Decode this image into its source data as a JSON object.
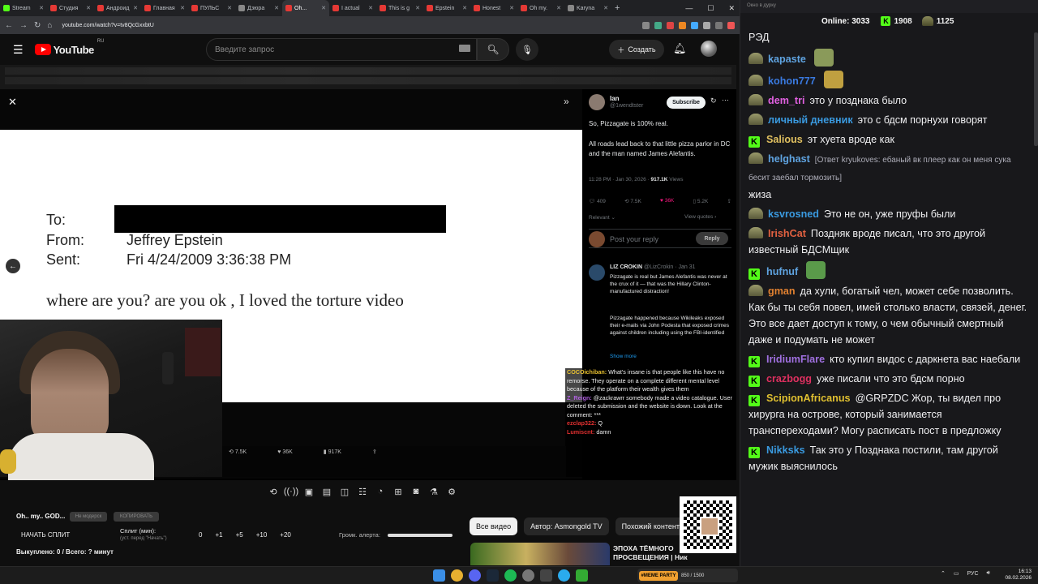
{
  "browser": {
    "tabs": [
      "Stream",
      "Студия",
      "Андроид",
      "Главная",
      "ПУЛЬС",
      "Дзюра",
      "Oh...",
      "I actual",
      "This is g",
      "Epstein",
      "Honest",
      "Oh my.",
      "Karyna"
    ],
    "active_tab": 6,
    "url": "youtube.com/watch?v=tv8QcGxxbtU"
  },
  "youtube": {
    "logo": "YouTube",
    "region": "RU",
    "search_placeholder": "Введите запрос",
    "create_label": "Создать"
  },
  "tweet": {
    "name": "Ian",
    "handle": "@1wendtster",
    "subscribe": "Subscribe",
    "text1": "So, Pizzagate is 100% real.",
    "text2": "All roads lead back to that little pizza parlor in DC and the man named James Alefantis.",
    "time": "11:28 PM · Jan 30, 2026 · ",
    "views": "917.1K",
    "views_label": " Views",
    "replies": "409",
    "retweets": "7.5K",
    "likes": "36K",
    "bookmarks": "5.2K",
    "relevant": "Relevant ⌄",
    "view_quotes": "View quotes ›",
    "reply_placeholder": "Post your reply",
    "reply_button": "Reply",
    "liz_name": "LIZ CROKIN",
    "liz_meta": " @LizCrokin · Jan 31",
    "liz_text1": "Pizzagate is real but James Alefantis was never at the crux of it — that was the Hillary Clinton-manufactured distraction!",
    "liz_text2": "Pizzagate happened because Wikileaks exposed their e-mails via John Podesta that exposed crimes against children including using the FBI-identified",
    "show_more": "Show more"
  },
  "document": {
    "to_label": "To:",
    "from_label": "From:",
    "from_value": "Jeffrey Epstein",
    "sent_label": "Sent:",
    "sent_value": "Fri 4/24/2009 3:36:38 PM",
    "body": "where are you? are you ok , I loved the torture video"
  },
  "video_footer": {
    "retweets": "7.5K",
    "likes": "36K",
    "views": "917K"
  },
  "chat_overlay": [
    {
      "user": "COCOichiban:",
      "color": "#e8c030",
      "text": " What's insane is that people like this have no remorse. They operate on a complete different mental level because of the platform their wealth gives them"
    },
    {
      "user": "Z_Reign:",
      "color": "#b060e0",
      "text": " @zackrawrr somebody made a video catalogue. User deleted the submission and the website is down. Look at the comment: ***"
    },
    {
      "user": "ezclap322:",
      "color": "#e03030",
      "text": " Q"
    },
    {
      "user": "Lumiscnt:",
      "color": "#e03030",
      "text": " damn"
    }
  ],
  "bottom": {
    "title": "Oh.. my.. GOD...",
    "no_mod": "Не модерск",
    "copy": "КОПИРОВАТЬ",
    "split_button": "НАЧАТЬ СПЛИТ",
    "split_label": "Сплит (мин):",
    "split_sub": "(уст. перед \"Начать\")",
    "split_values": [
      "0",
      "+1",
      "+5",
      "+10",
      "+20"
    ],
    "alert_label": "Громк. алерта:",
    "bought": "Выкуплено: 0 / Всего: ? минут"
  },
  "chips": [
    "Все видео",
    "Автор: Asmongold TV",
    "Похожий контент"
  ],
  "next_video": {
    "title": "ЭПОХА ТЁМНОГО ПРОСВЕЩЕНИЯ | Ник ..."
  },
  "chat": {
    "header": "Окно в дурку",
    "online_label": "Online: ",
    "online": "3033",
    "kick_count": "1908",
    "gold_count": "1125",
    "messages": [
      {
        "badge": "none",
        "user": "",
        "color": "#efeff1",
        "reply": "",
        "text": "РЭД",
        "emote": ""
      },
      {
        "badge": "gold",
        "user": "kapaste",
        "color": "#5fa3e0",
        "reply": "",
        "text": "",
        "emote": "#8a9a5a"
      },
      {
        "badge": "gold",
        "user": "kohon777",
        "color": "#3a7ae0",
        "reply": "",
        "text": "",
        "emote": "#c0a040"
      },
      {
        "badge": "gold",
        "user": "dem_tri",
        "color": "#e060e0",
        "reply": "",
        "text": "это у позднака было",
        "emote": ""
      },
      {
        "badge": "gold",
        "user": "личный дневник",
        "color": "#3a9ae0",
        "reply": "",
        "text": "это с бдсм порнухи говорят",
        "emote": ""
      },
      {
        "badge": "kick",
        "user": "Salious",
        "color": "#e0c060",
        "reply": "",
        "text": "эт хуета вроде как",
        "emote": ""
      },
      {
        "badge": "gold",
        "user": "helghast",
        "color": "#5fa3e0",
        "reply": "[Ответ kryukoves: ебаный вк плеер как он меня сука бесит заебал тормозить]",
        "text": "жиза",
        "emote": ""
      },
      {
        "badge": "gold",
        "user": "ksvrosned",
        "color": "#3a9ae0",
        "reply": "",
        "text": "Это не он, уже пруфы были",
        "emote": ""
      },
      {
        "badge": "gold",
        "user": "IrishCat",
        "color": "#e06040",
        "reply": "",
        "text": "Поздняк вроде писал, что это другой известный БДСМщик",
        "emote": ""
      },
      {
        "badge": "kick",
        "user": "hufnuf",
        "color": "#5fa3e0",
        "reply": "",
        "text": "",
        "emote": "#5a9a4a"
      },
      {
        "badge": "gold",
        "user": "gman",
        "color": "#e08030",
        "reply": "",
        "text": "да хули, богатый чел, может себе позволить. Как бы ты себя повел, имей столько власти, связей, денег. Это все дает доступ к тому, о чем обычный смертный даже и подумать не может",
        "emote": ""
      },
      {
        "badge": "kick",
        "user": "IridiumFlare",
        "color": "#a070e0",
        "reply": "",
        "text": "кто купил видос с даркнета вас наебали",
        "emote": ""
      },
      {
        "badge": "kick",
        "user": "crazbogg",
        "color": "#e03060",
        "reply": "",
        "text": "уже писали что это бдсм порно",
        "emote": ""
      },
      {
        "badge": "kick",
        "user": "ScipionAfricanus",
        "color": "#e0c030",
        "reply": "",
        "text": "@GRPZDC Жор, ты видел про хирурга на острове, который занимается трансперeходами? Могу расписать пост в предложку",
        "emote": ""
      },
      {
        "badge": "kick",
        "user": "Nikksks",
        "color": "#3a9ae0",
        "reply": "",
        "text": "Так это у Позднака постили, там другой мужик выяснилось",
        "emote": ""
      }
    ]
  },
  "taskbar": {
    "widget_label": "#MEME PARTY",
    "widget_value": "850 / 1500",
    "lang": "РУС",
    "time": "16:13",
    "date": "08.02.2026"
  }
}
